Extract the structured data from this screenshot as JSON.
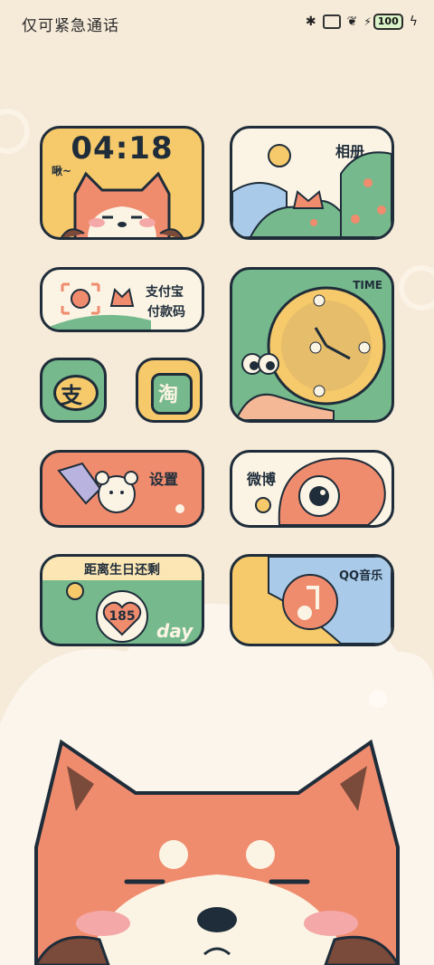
{
  "status_bar": {
    "carrier_text": "仅可紧急通话",
    "battery_level": "100"
  },
  "widgets": {
    "clock": {
      "time": "04:18",
      "caption": "啾~"
    },
    "album": {
      "label": "相册"
    },
    "alipay_pay": {
      "label_line1": "支付宝",
      "label_line2": "付款码"
    },
    "time_clock": {
      "label": "TIME"
    },
    "settings": {
      "label": "设置"
    },
    "weibo": {
      "label": "微博"
    },
    "countdown": {
      "title": "距离生日还剩",
      "days": "185",
      "unit": "day"
    },
    "qqmusic": {
      "label": "QQ音乐"
    }
  },
  "icons": {
    "alipay": {
      "glyph": "支"
    },
    "taobao": {
      "glyph": "淘"
    }
  },
  "colors": {
    "background": "#f6ead9",
    "outline": "#1f2d3a",
    "yellow": "#f6c96b",
    "green": "#76b98d",
    "salmon": "#f08c6e",
    "cream": "#fbf4e4",
    "blue": "#a9cbe9"
  }
}
